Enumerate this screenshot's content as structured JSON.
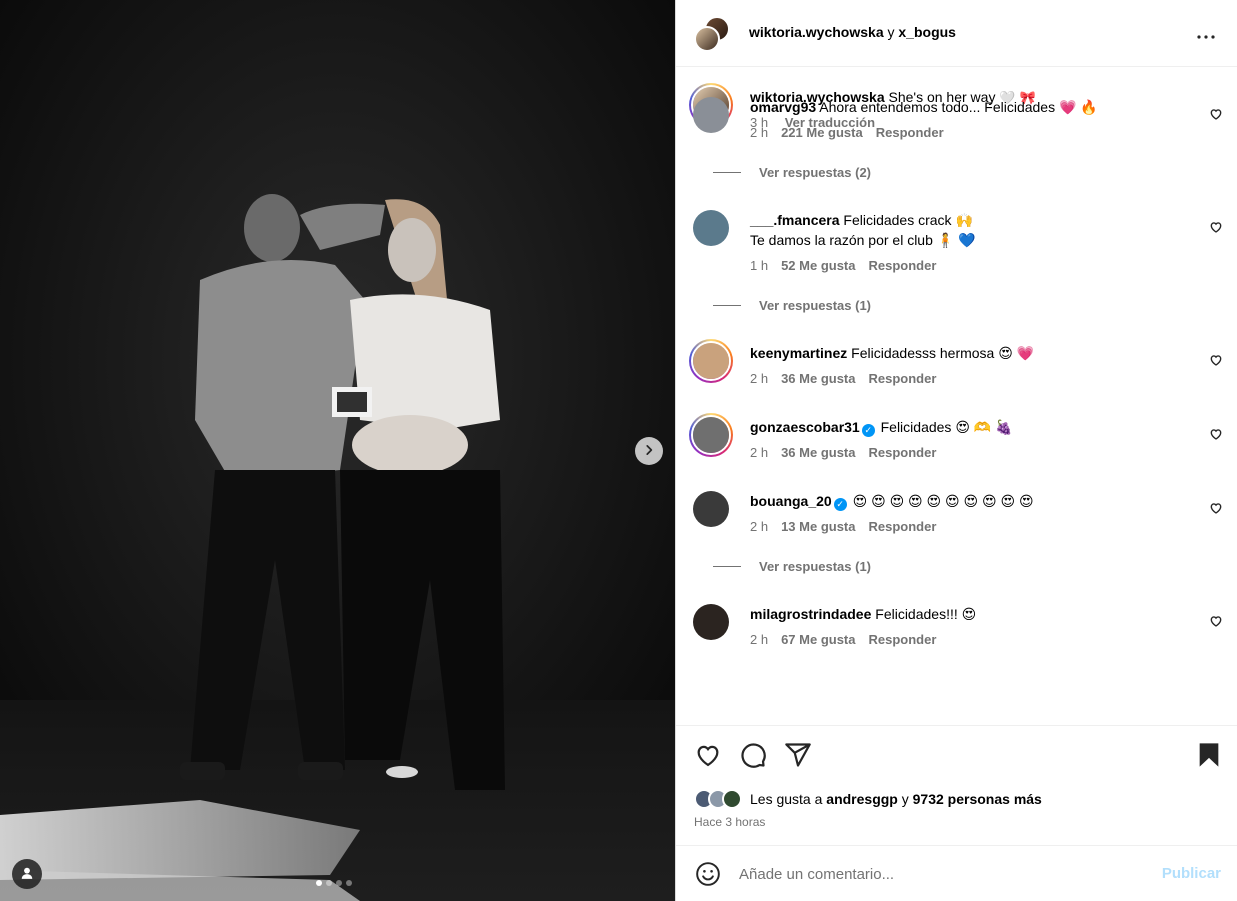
{
  "header": {
    "user1": "wiktoria.wychowska",
    "joiner": "y",
    "user2": "x_bogus",
    "more_icon": "more-horizontal-icon"
  },
  "caption": {
    "user": "wiktoria.wychowska",
    "text": "She's on her way",
    "emojis": "🤍 🎀",
    "time": "3 h",
    "translate": "Ver traducción"
  },
  "comments": [
    {
      "user": "omarvg93",
      "verified": false,
      "lines": [
        "Ahora entendemos todo... Felicidades 💗 🔥"
      ],
      "time": "2 h",
      "likes": "221 Me gusta",
      "reply": "Responder",
      "replies": "Ver respuestas (2)",
      "avatar_color": "#8a8f97"
    },
    {
      "user": "___.fmancera",
      "verified": false,
      "lines": [
        "Felicidades crack 🙌",
        "Te damos la razón por el club 🧍 💙"
      ],
      "time": "1 h",
      "likes": "52 Me gusta",
      "reply": "Responder",
      "replies": "Ver respuestas (1)",
      "avatar_color": "#5b7a8c"
    },
    {
      "user": "keenymartinez",
      "verified": false,
      "lines": [
        "Felicidadesss hermosa 😍 💗"
      ],
      "time": "2 h",
      "likes": "36 Me gusta",
      "reply": "Responder",
      "replies": "",
      "avatar_color": "#c9a27d",
      "ring": true
    },
    {
      "user": "gonzaescobar31",
      "verified": true,
      "lines": [
        "Felicidades 😍 🫶 🍇"
      ],
      "time": "2 h",
      "likes": "36 Me gusta",
      "reply": "Responder",
      "replies": "",
      "avatar_color": "#6f6f6f",
      "ring": true
    },
    {
      "user": "bouanga_20",
      "verified": true,
      "lines": [
        "😍 😍 😍 😍 😍 😍 😍 😍 😍 😍"
      ],
      "time": "2 h",
      "likes": "13 Me gusta",
      "reply": "Responder",
      "replies": "Ver respuestas (1)",
      "avatar_color": "#3a3a3a"
    },
    {
      "user": "milagrostrindadee",
      "verified": false,
      "lines": [
        "Felicidades!!! 😍"
      ],
      "time": "2 h",
      "likes": "67 Me gusta",
      "reply": "Responder",
      "replies": "",
      "avatar_color": "#2b2420"
    }
  ],
  "actions": {
    "like_icon": "heart-outline-icon",
    "comment_icon": "comment-bubble-icon",
    "share_icon": "paper-plane-icon",
    "save_icon": "bookmark-filled-icon",
    "likes_prefix": "Les gusta a",
    "likes_user": "andresggp",
    "likes_joiner": "y",
    "likes_count": "9732 personas más",
    "time_ago": "Hace 3 horas"
  },
  "composer": {
    "placeholder": "Añade un comentario...",
    "publish": "Publicar",
    "emoji_icon": "smiley-icon"
  },
  "media": {
    "next_icon": "chevron-right-icon",
    "tag_icon": "user-tag-icon",
    "slides": 4,
    "active_slide": 1
  },
  "colors": {
    "accent_blue": "#0095f6",
    "publish_disabled": "#b2dffc",
    "secondary_text": "#737373"
  }
}
